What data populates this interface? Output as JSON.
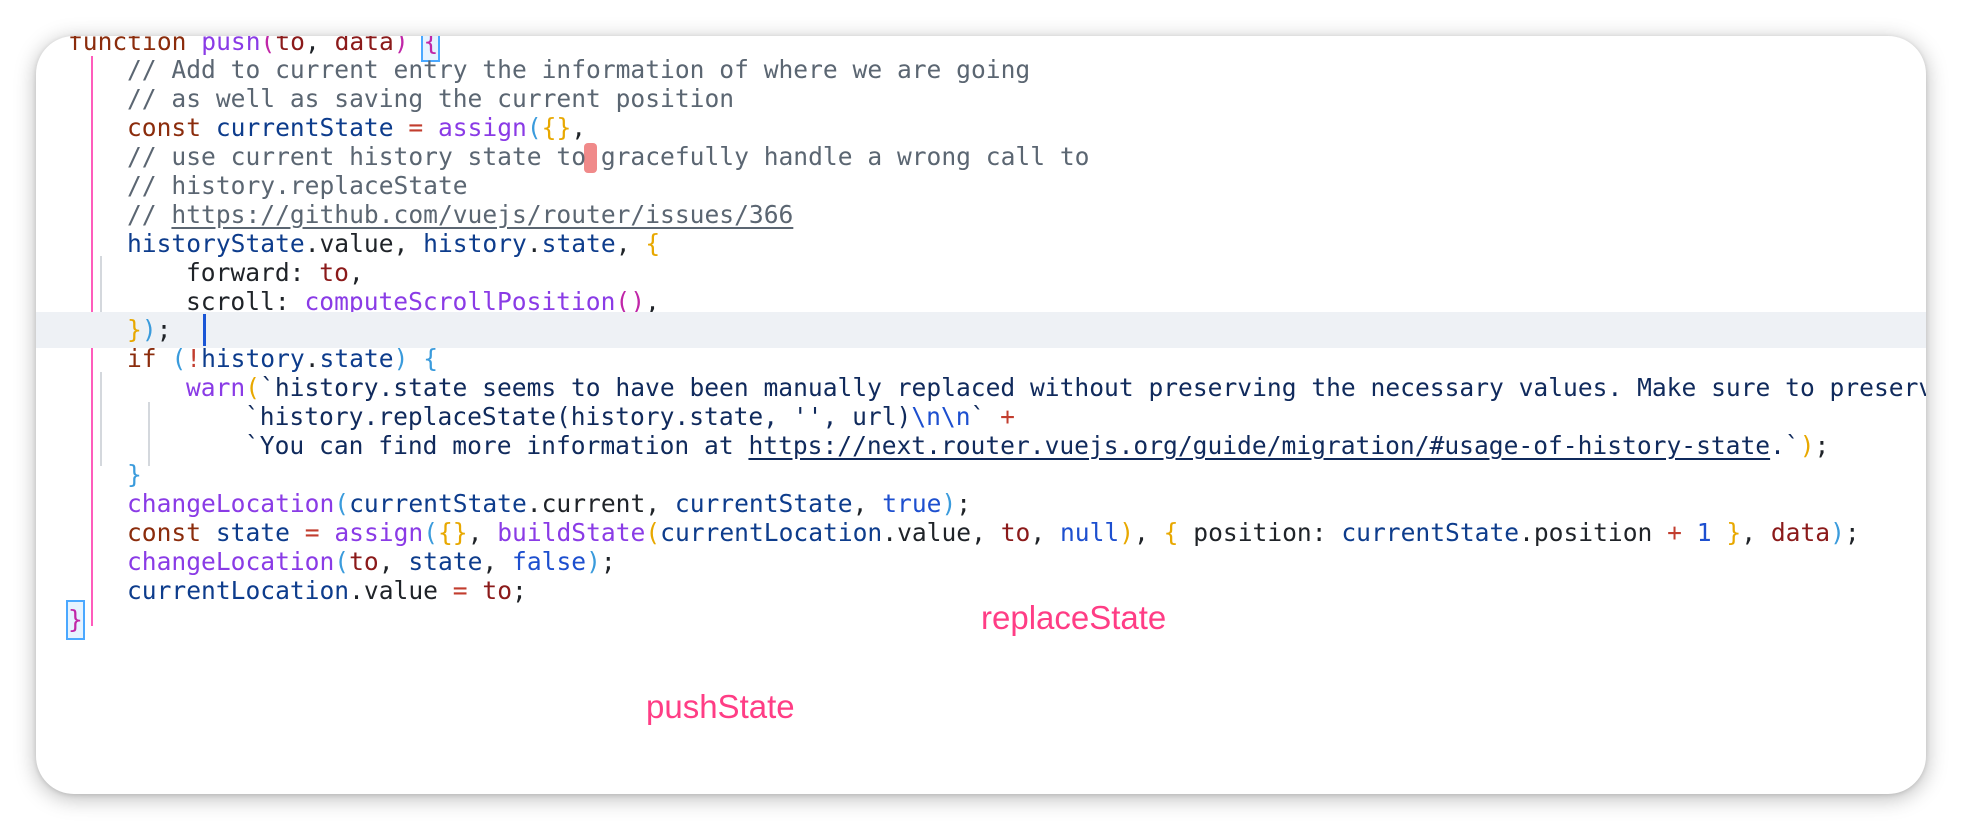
{
  "code": {
    "kw_function": "function",
    "fn_push": "push",
    "param_to": "to",
    "param_data": "data",
    "comment_add": "// Add to current entry the information of where we are going",
    "comment_as_well": "// as well as saving the current position",
    "kw_const": "const",
    "var_currentState": "currentState",
    "fn_assign": "assign",
    "comment_use": "// use current history state to gracefully handle a wrong call to",
    "comment_replaceState": "// history.replaceState",
    "comment_prefix": "// ",
    "comment_issue_url": "https://github.com/vuejs/router/issues/366",
    "var_historyState": "historyState",
    "prop_value": "value",
    "var_history": "history",
    "prop_state": "state",
    "key_forward": "forward",
    "key_scroll": "scroll",
    "fn_computeScrollPosition": "computeScrollPosition",
    "kw_if": "if",
    "fn_warn": "warn",
    "warn_str1": "`history.state seems to have been manually replaced without preserving the necessary values. Make sure to preserv",
    "warn_str2_a": "`history.replaceState(history.state, '', url)",
    "warn_str2_esc": "\\n\\n",
    "warn_str2_b": "`",
    "warn_str3_a": "`You can find more information at ",
    "warn_str3_url": "https://next.router.vuejs.org/guide/migration/#usage-of-history-state",
    "warn_str3_b": ".`",
    "fn_changeLocation": "changeLocation",
    "prop_current": "current",
    "lit_true": "true",
    "lit_false": "false",
    "lit_null": "null",
    "var_state": "state",
    "fn_buildState": "buildState",
    "var_currentLocation": "currentLocation",
    "key_position": "position",
    "prop_position": "position",
    "num_one": "1"
  },
  "annotations": {
    "replace_state": "replaceState",
    "push_state": "pushState"
  },
  "colors": {
    "annotation": "#ff3d85",
    "keyword": "#8b2c0c",
    "function": "#8a3be6",
    "comment": "#5b6672",
    "indent_guide": "#ff5cbc"
  }
}
